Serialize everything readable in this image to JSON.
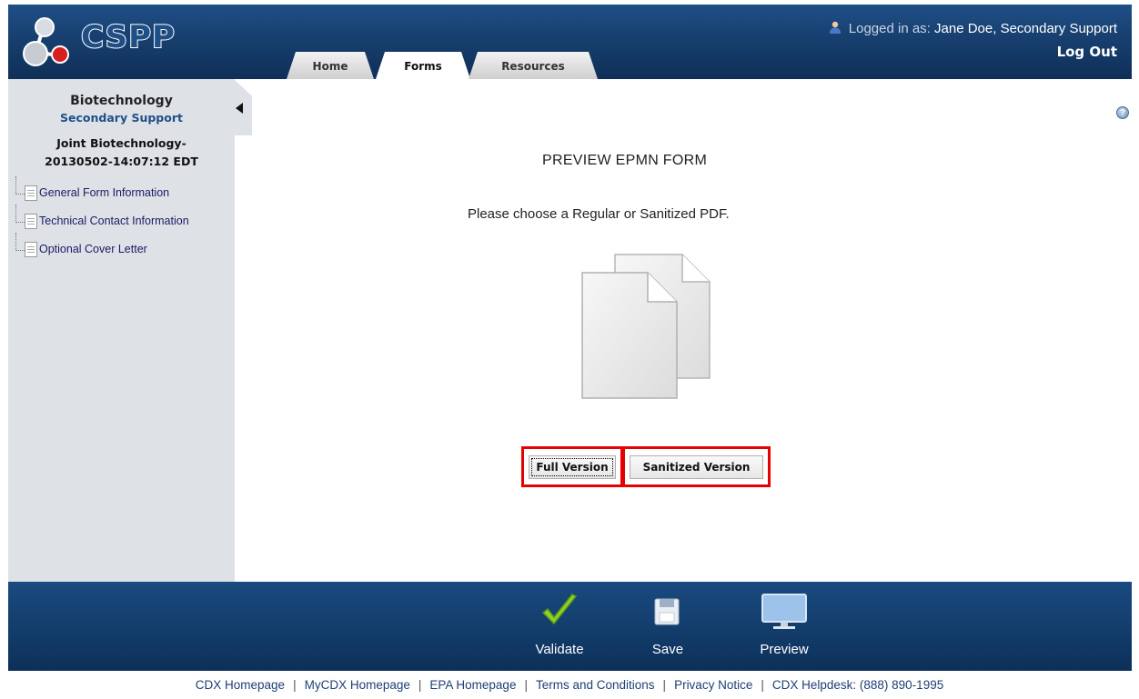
{
  "header": {
    "logo_text": "CSPP",
    "tabs": [
      {
        "label": "Home"
      },
      {
        "label": "Forms"
      },
      {
        "label": "Resources"
      }
    ],
    "user_prefix": "Logged in as:",
    "user_name": "Jane Doe, Secondary Support",
    "logout_label": "Log Out"
  },
  "sidebar": {
    "title": "Biotechnology",
    "subtitle": "Secondary Support",
    "form_name_line1": "Joint Biotechnology-",
    "form_name_line2": "20130502-14:07:12 EDT",
    "items": [
      {
        "label": "General Form Information"
      },
      {
        "label": "Technical Contact Information"
      },
      {
        "label": "Optional Cover Letter"
      }
    ]
  },
  "main": {
    "title": "PREVIEW EPMN FORM",
    "instruction": "Please choose a Regular or Sanitized PDF.",
    "full_version_label": "Full Version",
    "sanitized_version_label": "Sanitized Version"
  },
  "toolbar": {
    "validate_label": "Validate",
    "save_label": "Save",
    "preview_label": "Preview"
  },
  "footer": {
    "links": [
      {
        "label": "CDX Homepage"
      },
      {
        "label": "MyCDX Homepage"
      },
      {
        "label": "EPA Homepage"
      },
      {
        "label": "Terms and Conditions"
      },
      {
        "label": "Privacy Notice"
      },
      {
        "label": "CDX Helpdesk: (888) 890-1995"
      }
    ]
  },
  "colors": {
    "header_blue": "#1f4f87",
    "sidebar_bg": "#dee2e6",
    "highlight_red": "#e60000",
    "link_blue": "#1f3f75"
  }
}
